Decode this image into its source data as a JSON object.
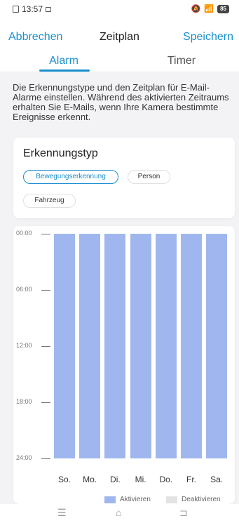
{
  "status_bar": {
    "time": "13:57",
    "battery": "85"
  },
  "header": {
    "cancel_label": "Abbrechen",
    "title": "Zeitplan",
    "save_label": "Speichern"
  },
  "tabs": [
    {
      "label": "Alarm",
      "selected": true
    },
    {
      "label": "Timer",
      "selected": false
    }
  ],
  "description": "Die Erkennungstype und den Zeitplan für E-Mail-Alarme einstellen. Während des aktivierten Zeitraums erhalten Sie E-Mails, wenn Ihre Kamera bestimmte Ereignisse erkennt.",
  "detection": {
    "title": "Erkennungstyp",
    "options": [
      {
        "label": "Bewegungserkennung",
        "selected": true
      },
      {
        "label": "Person",
        "selected": false
      },
      {
        "label": "Fahrzeug",
        "selected": false
      }
    ]
  },
  "chart_data": {
    "type": "bar",
    "categories": [
      "So.",
      "Mo.",
      "Di.",
      "Mi.",
      "Do.",
      "Fr.",
      "Sa."
    ],
    "y_tick_labels": [
      "00:00",
      "06:00",
      "12:00",
      "18:00",
      "24:00"
    ],
    "series": [
      {
        "name": "Aktivieren",
        "ranges": [
          [
            0,
            24
          ],
          [
            0,
            24
          ],
          [
            0,
            24
          ],
          [
            0,
            24
          ],
          [
            0,
            24
          ],
          [
            0,
            24
          ],
          [
            0,
            24
          ]
        ]
      }
    ],
    "legend": [
      {
        "label": "Aktivieren",
        "color": "#9fb7ee"
      },
      {
        "label": "Deaktivieren",
        "color": "#e3e3e3"
      }
    ]
  },
  "colors": {
    "accent": "#1a8fd0",
    "active_bar": "#9fb7ee",
    "inactive": "#e3e3e3"
  },
  "nav_icons": [
    "menu-icon",
    "home-icon",
    "back-icon"
  ]
}
